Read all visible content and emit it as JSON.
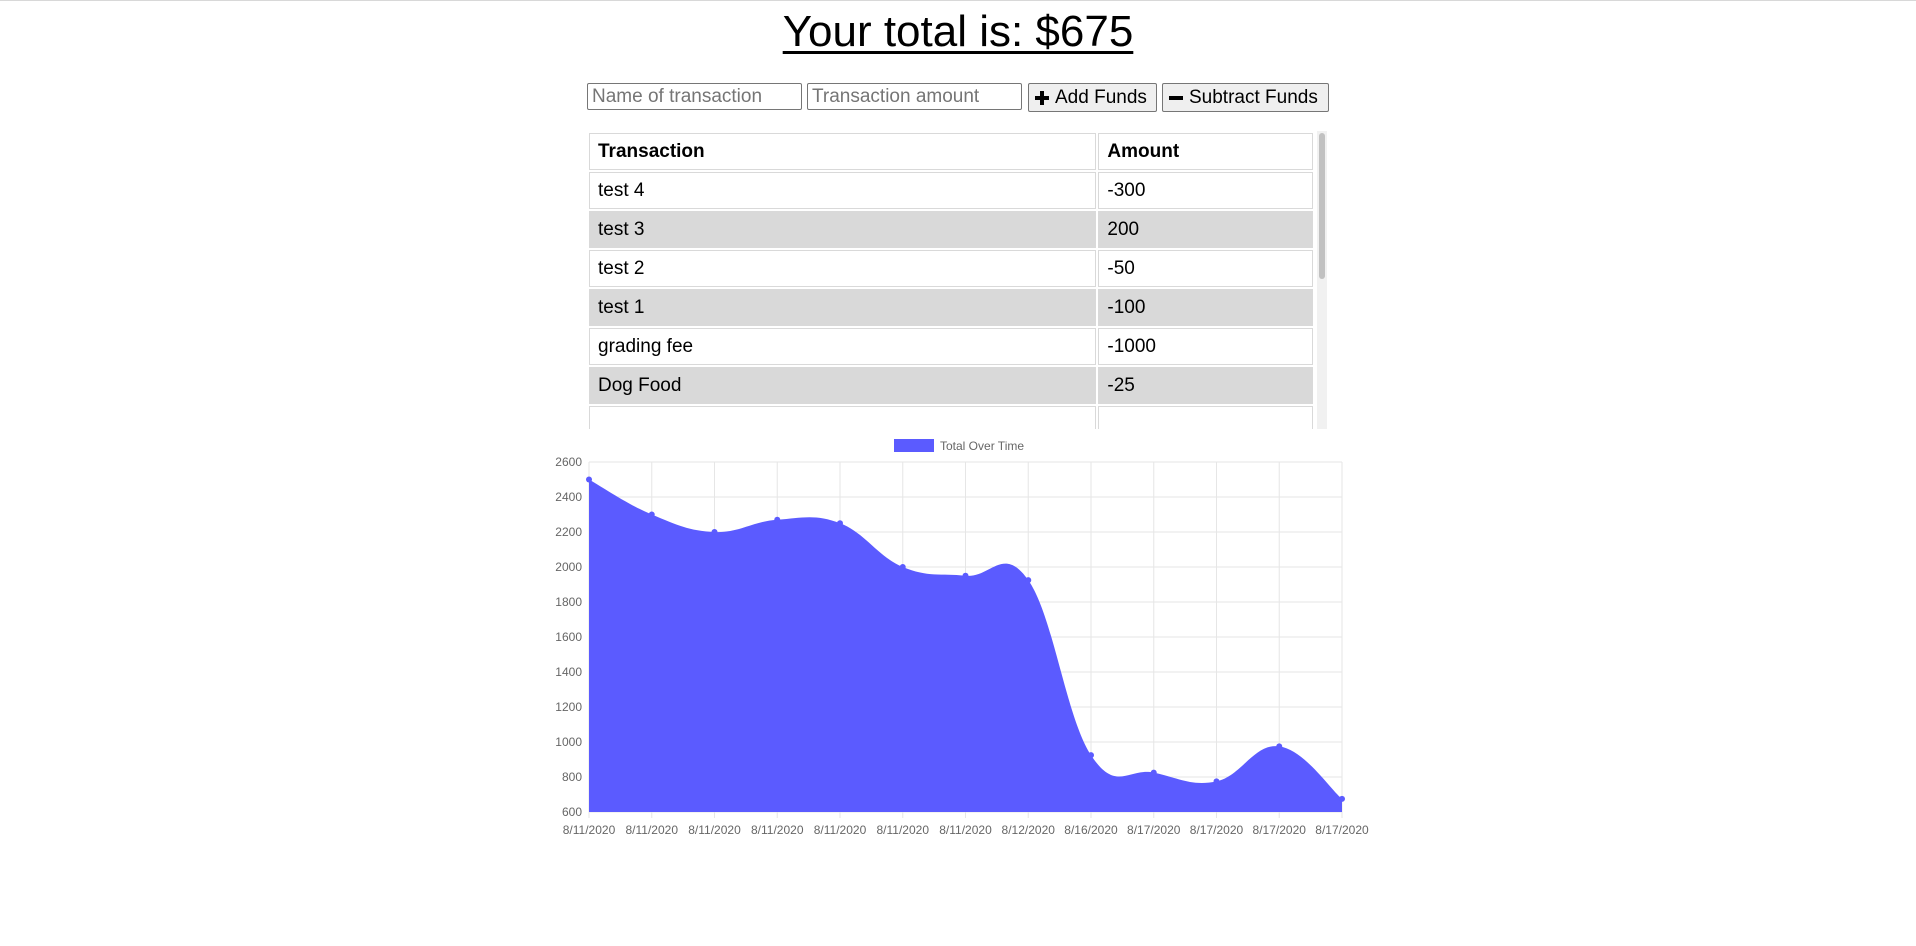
{
  "header": {
    "total_text": "Your total is: $675"
  },
  "form": {
    "name_placeholder": "Name of transaction",
    "amount_placeholder": "Transaction amount",
    "add_label": "Add Funds",
    "subtract_label": "Subtract Funds",
    "add_icon": "plus-icon",
    "subtract_icon": "minus-icon"
  },
  "table": {
    "headers": [
      "Transaction",
      "Amount"
    ],
    "rows": [
      {
        "name": "test 4",
        "amount": "-300"
      },
      {
        "name": "test 3",
        "amount": "200"
      },
      {
        "name": "test 2",
        "amount": "-50"
      },
      {
        "name": "test 1",
        "amount": "-100"
      },
      {
        "name": "grading fee",
        "amount": "-1000"
      },
      {
        "name": "Dog Food",
        "amount": "-25"
      }
    ]
  },
  "colors": {
    "series_fill": "#5b5bff",
    "row_alt": "#d9d9d9",
    "grid": "#e6e6e6"
  },
  "chart_data": {
    "type": "area",
    "legend_position": "top",
    "grid": true,
    "x": [
      "8/11/2020",
      "8/11/2020",
      "8/11/2020",
      "8/11/2020",
      "8/11/2020",
      "8/11/2020",
      "8/11/2020",
      "8/12/2020",
      "8/16/2020",
      "8/17/2020",
      "8/17/2020",
      "8/17/2020",
      "8/17/2020"
    ],
    "series": [
      {
        "name": "Total Over Time",
        "values": [
          2500,
          2300,
          2200,
          2270,
          2250,
          2000,
          1950,
          1925,
          925,
          825,
          775,
          975,
          675
        ]
      }
    ],
    "ylim": [
      600,
      2600
    ],
    "yticks": [
      600,
      800,
      1000,
      1200,
      1400,
      1600,
      1800,
      2000,
      2200,
      2400,
      2600
    ]
  }
}
